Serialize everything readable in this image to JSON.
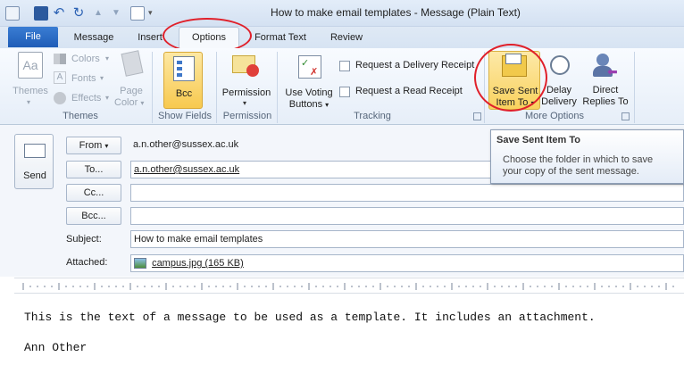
{
  "window": {
    "title": "How to make email templates  -  Message (Plain Text)"
  },
  "tabs": {
    "file": "File",
    "message": "Message",
    "insert": "Insert",
    "options": "Options",
    "format_text": "Format Text",
    "review": "Review"
  },
  "ribbon": {
    "themes": {
      "themes_label": "Themes",
      "colors_label": "Colors",
      "fonts_label": "Fonts",
      "effects_label": "Effects",
      "page_color_l1": "Page",
      "page_color_l2": "Color",
      "group": "Themes"
    },
    "show_fields": {
      "bcc_label": "Bcc",
      "group": "Show Fields"
    },
    "permission": {
      "label": "Permission",
      "group": "Permission"
    },
    "tracking": {
      "voting_l1": "Use Voting",
      "voting_l2": "Buttons",
      "delivery_receipt": "Request a Delivery Receipt",
      "read_receipt": "Request a Read Receipt",
      "group": "Tracking"
    },
    "more_options": {
      "save_sent_l1": "Save Sent",
      "save_sent_l2": "Item To",
      "delay_l1": "Delay",
      "delay_l2": "Delivery",
      "direct_l1": "Direct",
      "direct_l2": "Replies To",
      "group": "More Options"
    }
  },
  "composer": {
    "send_label": "Send",
    "from_label": "From",
    "from_value": "a.n.other@sussex.ac.uk",
    "to_label": "To...",
    "to_value": "a.n.other@sussex.ac.uk",
    "cc_label": "Cc...",
    "cc_value": "",
    "bcc_label": "Bcc...",
    "bcc_value": "",
    "subject_label": "Subject:",
    "subject_value": "How to make email templates",
    "attached_label": "Attached:",
    "attachment": "campus.jpg (165 KB)"
  },
  "tooltip": {
    "title": "Save Sent Item To",
    "line1": "Choose the folder in which to save",
    "line2": "your copy of the sent message."
  },
  "body": {
    "line1": "This is the text of a message to be used as a template.   It includes an attachment.",
    "line2": "Ann Other"
  },
  "colors": {
    "accent": "#1f5db7",
    "highlight": "#f9d768",
    "annotation": "#e0202a"
  }
}
